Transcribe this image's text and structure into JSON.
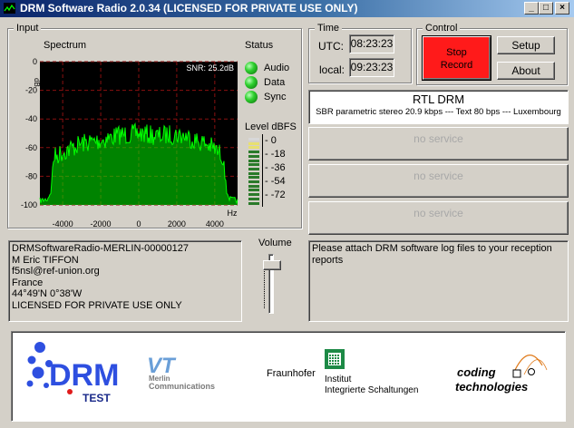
{
  "window": {
    "title": "DRM Software Radio 2.0.34 (LICENSED FOR PRIVATE USE ONLY)"
  },
  "input": {
    "group_label": "Input",
    "spectrum_label": "Spectrum",
    "snr_text": "SNR: 25.2dB",
    "ylabel": "dB",
    "y_ticks": [
      "0",
      "-20",
      "-40",
      "-60",
      "-80",
      "-100"
    ],
    "x_ticks": [
      "-4000",
      "-2000",
      "0",
      "2000",
      "4000"
    ],
    "x_unit": "Hz",
    "status_label": "Status",
    "status_items": [
      "Audio",
      "Data",
      "Sync"
    ],
    "level_label": "Level dBFS",
    "level_ticks": [
      "0",
      "-18",
      "-36",
      "-54",
      "-72"
    ]
  },
  "time": {
    "group_label": "Time",
    "utc_label": "UTC:",
    "utc_value": "08:23:23",
    "local_label": "local:",
    "local_value": "09:23:23"
  },
  "control": {
    "group_label": "Control",
    "stop_record": "Stop Record",
    "setup": "Setup",
    "about": "About",
    "accent": "#ff1a1a"
  },
  "services": [
    {
      "name": "RTL DRM",
      "details": "SBR parametric stereo 20.9 kbps --- Text 80 bps --- Luxembourg"
    },
    {
      "name": "no service"
    },
    {
      "name": "no service"
    },
    {
      "name": "no service"
    }
  ],
  "receiver_info": [
    "DRMSoftwareRadio-MERLIN-00000127",
    "M Eric TIFFON",
    "f5nsl@ref-union.org",
    "France",
    "44°49'N   0°38'W",
    "LICENSED FOR PRIVATE USE ONLY"
  ],
  "volume_label": "Volume",
  "volume_level": 0.92,
  "message": "Please attach DRM software log files to your reception reports",
  "logos": {
    "drm": "DRM",
    "drm_sub": "TEST",
    "vt": "VT",
    "vt_name1": "Merlin",
    "vt_name2": "Communications",
    "fraunhofer": "Fraunhofer",
    "iis1": "Institut",
    "iis2": "Integrierte Schaltungen",
    "coding1": "coding",
    "coding2": "technologies"
  },
  "chart_data": {
    "type": "line",
    "xlabel": "Hz",
    "ylabel": "dB",
    "xlim": [
      -5200,
      5200
    ],
    "ylim": [
      -100,
      0
    ],
    "x": [
      -5200,
      -4800,
      -4600,
      -4500,
      -4000,
      -3500,
      -3000,
      -2500,
      -2000,
      -1500,
      -1000,
      -500,
      0,
      500,
      1000,
      1500,
      2000,
      2500,
      3000,
      3500,
      4000,
      4500,
      4600,
      4800,
      5200
    ],
    "y": [
      -97,
      -96,
      -90,
      -64,
      -60,
      -57,
      -54,
      -53,
      -52,
      -50,
      -48,
      -48,
      -47,
      -48,
      -49,
      -48,
      -48,
      -49,
      -52,
      -54,
      -58,
      -64,
      -90,
      -96,
      -97
    ],
    "line_color": "#00ff00"
  }
}
